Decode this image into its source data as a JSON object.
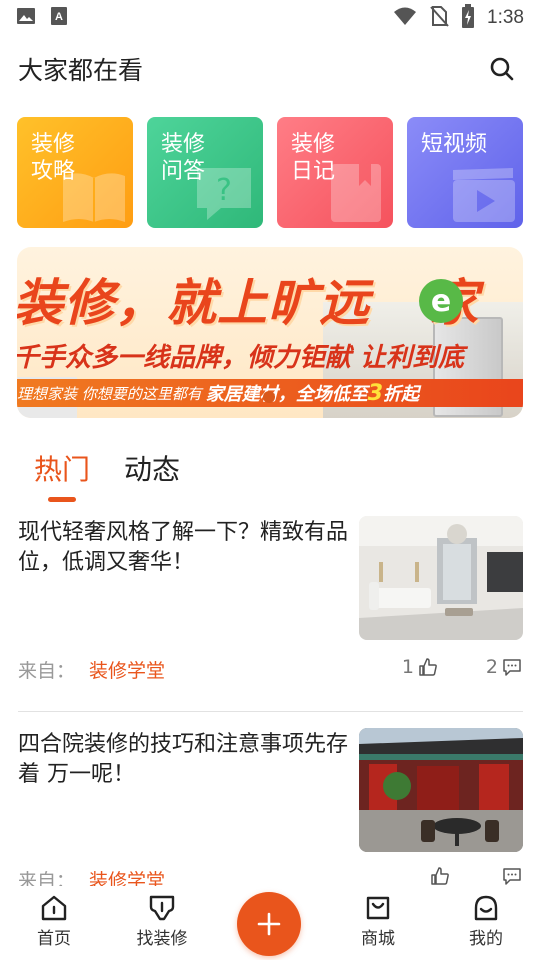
{
  "status_bar": {
    "time": "1:38",
    "left_icons": [
      "image-icon",
      "text-a-icon"
    ],
    "right_icons": [
      "wifi-icon",
      "no-sim-icon",
      "battery-charging-icon"
    ]
  },
  "header": {
    "title": "大家都在看",
    "search_icon": "search-icon"
  },
  "tiles": [
    {
      "label": "装修\n攻略",
      "icon": "book-icon",
      "color": "#ffb31c"
    },
    {
      "label": "装修\n问答",
      "icon": "question-bubble-icon",
      "color": "#3cc585"
    },
    {
      "label": "装修\n日记",
      "icon": "diary-icon",
      "color": "#f86870"
    },
    {
      "label": "短视频",
      "icon": "video-clapper-icon",
      "color": "#7476f1"
    }
  ],
  "banner": {
    "headline": "装修，就上旷远",
    "logo_text": "e",
    "headline_tail": "家",
    "sub": "千手众多一线品牌，倾力钜献  让利到底",
    "strip_a": "理想家装 你想要的这里都有",
    "strip_b": "家居建材，全场低至",
    "strip_highlight": "3",
    "strip_c": "折起"
  },
  "tabs": [
    {
      "label": "热门",
      "active": true
    },
    {
      "label": "动态",
      "active": false
    }
  ],
  "feed": [
    {
      "title": "现代轻奢风格了解一下？精致有品位，低调又奢华！",
      "source_prefix": "来自：",
      "source_name": "装修学堂",
      "likes": "1",
      "comments": "2",
      "thumb": "modern-living-room"
    },
    {
      "title": "四合院装修的技巧和注意事项先存着 万一呢！",
      "source_prefix": "来自：",
      "source_name": "装修学堂",
      "likes": "",
      "comments": "",
      "thumb": "courtyard-house"
    }
  ],
  "bottom_nav": {
    "items": [
      {
        "label": "首页",
        "icon": "home-icon"
      },
      {
        "label": "找装修",
        "icon": "flag-icon"
      },
      {
        "label": "商城",
        "icon": "shopping-bag-icon"
      },
      {
        "label": "我的",
        "icon": "profile-icon"
      }
    ],
    "fab_icon": "plus-icon",
    "accent": "#e9551c"
  }
}
